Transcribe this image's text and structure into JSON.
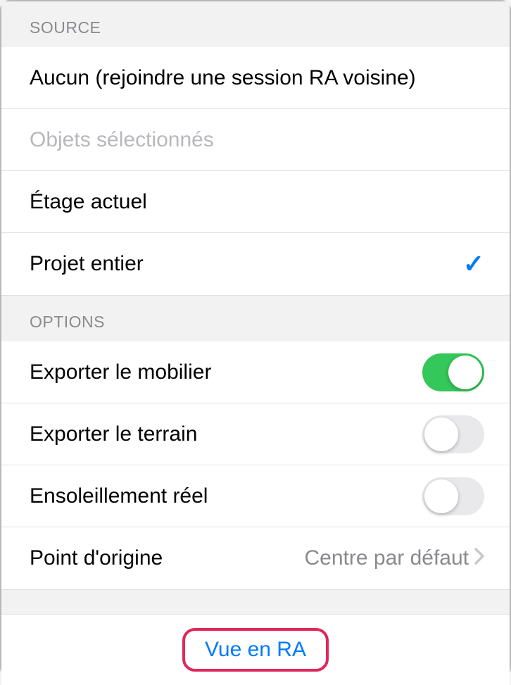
{
  "sections": {
    "source": {
      "header": "Source",
      "items": [
        {
          "label": "Aucun (rejoindre une session RA voisine)",
          "selected": false,
          "enabled": true
        },
        {
          "label": "Objets sélectionnés",
          "selected": false,
          "enabled": false
        },
        {
          "label": "Étage actuel",
          "selected": false,
          "enabled": true
        },
        {
          "label": "Projet entier",
          "selected": true,
          "enabled": true
        }
      ]
    },
    "options": {
      "header": "Options",
      "items": [
        {
          "label": "Exporter le mobilier",
          "type": "toggle",
          "on": true
        },
        {
          "label": "Exporter le terrain",
          "type": "toggle",
          "on": false
        },
        {
          "label": "Ensoleillement réel",
          "type": "toggle",
          "on": false
        },
        {
          "label": "Point d'origine",
          "type": "nav",
          "value": "Centre par défaut"
        }
      ]
    }
  },
  "action": {
    "label": "Vue en RA"
  }
}
